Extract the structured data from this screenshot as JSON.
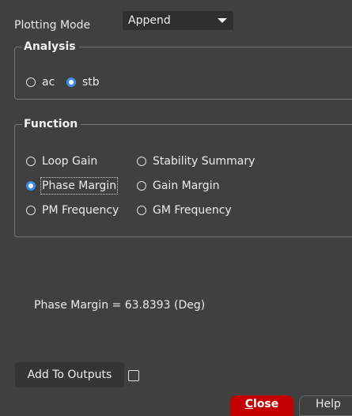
{
  "plotting_mode": {
    "label": "Plotting Mode",
    "selected": "Append"
  },
  "analysis": {
    "title": "Analysis",
    "options": [
      {
        "label": "ac",
        "checked": false
      },
      {
        "label": "stb",
        "checked": true
      }
    ]
  },
  "function": {
    "title": "Function",
    "options": [
      {
        "label": "Loop Gain",
        "checked": false
      },
      {
        "label": "Stability Summary",
        "checked": false
      },
      {
        "label": "Phase Margin",
        "checked": true
      },
      {
        "label": "Gain Margin",
        "checked": false
      },
      {
        "label": "PM Frequency",
        "checked": false
      },
      {
        "label": "GM Frequency",
        "checked": false
      }
    ]
  },
  "result": {
    "text": "Phase Margin = 63.8393 (Deg)"
  },
  "add_to_outputs": {
    "label": "Add To Outputs",
    "checked": false
  },
  "buttons": {
    "close": "Close",
    "help": "Help"
  },
  "colors": {
    "background": "#404040",
    "radio_selected": "#3a8ee6",
    "close_button": "#c40000"
  }
}
